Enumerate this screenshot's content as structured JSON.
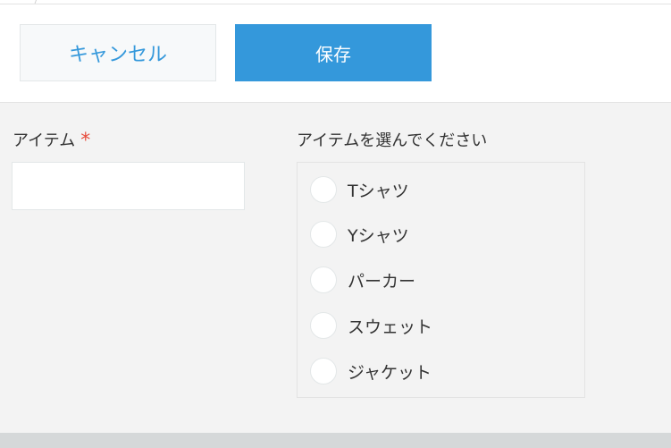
{
  "toolbar": {
    "cancel_label": "キャンセル",
    "save_label": "保存"
  },
  "form": {
    "item_field": {
      "label": "アイテム",
      "required_mark": "*",
      "value": ""
    },
    "choose_field": {
      "label": "アイテムを選んでください",
      "options": [
        {
          "label": "Tシャツ",
          "selected": false
        },
        {
          "label": "Yシャツ",
          "selected": false
        },
        {
          "label": "パーカー",
          "selected": false
        },
        {
          "label": "スウェット",
          "selected": false
        },
        {
          "label": "ジャケット",
          "selected": false
        }
      ]
    }
  },
  "colors": {
    "accent": "#3498db",
    "required": "#e74c3c",
    "background": "#f3f3f3"
  }
}
